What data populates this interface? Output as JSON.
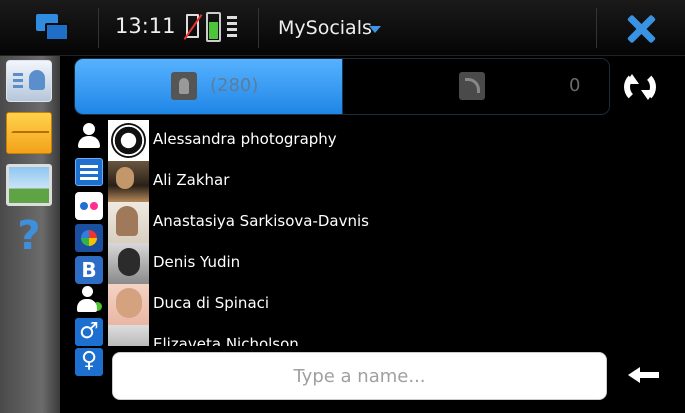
{
  "statusbar": {
    "time": "13:11",
    "app_title": "MySocials",
    "battery_level_fraction": 0.6,
    "icons": [
      "task-switcher-icon",
      "no-sim-icon",
      "battery-icon",
      "signal-icon",
      "dropdown-arrow-icon",
      "close-icon"
    ]
  },
  "sidebar": {
    "items": [
      {
        "name": "contacts-icon"
      },
      {
        "name": "mail-icon"
      },
      {
        "name": "photos-icon"
      },
      {
        "name": "help-icon",
        "glyph": "?"
      }
    ]
  },
  "tabs": {
    "contacts": {
      "count": "(280)",
      "icon": "address-book-icon"
    },
    "feeds": {
      "count": "0",
      "icon": "rss-icon"
    }
  },
  "filters": {
    "vk_label": "B",
    "male_glyph": "♂",
    "female_glyph": "♀"
  },
  "contacts": [
    {
      "name": "Alessandra photography"
    },
    {
      "name": "Ali Zakhar"
    },
    {
      "name": "Anastasiya Sarkisova-Davnis"
    },
    {
      "name": "Denis Yudin"
    },
    {
      "name": "Duca di Spinaci"
    },
    {
      "name": "Elizaveta Nicholson"
    }
  ],
  "search": {
    "placeholder": "Type a name...",
    "value": ""
  },
  "colors": {
    "accent": "#2f8ce0",
    "tab_active": "#3a9bf5",
    "online": "#4fc330"
  }
}
